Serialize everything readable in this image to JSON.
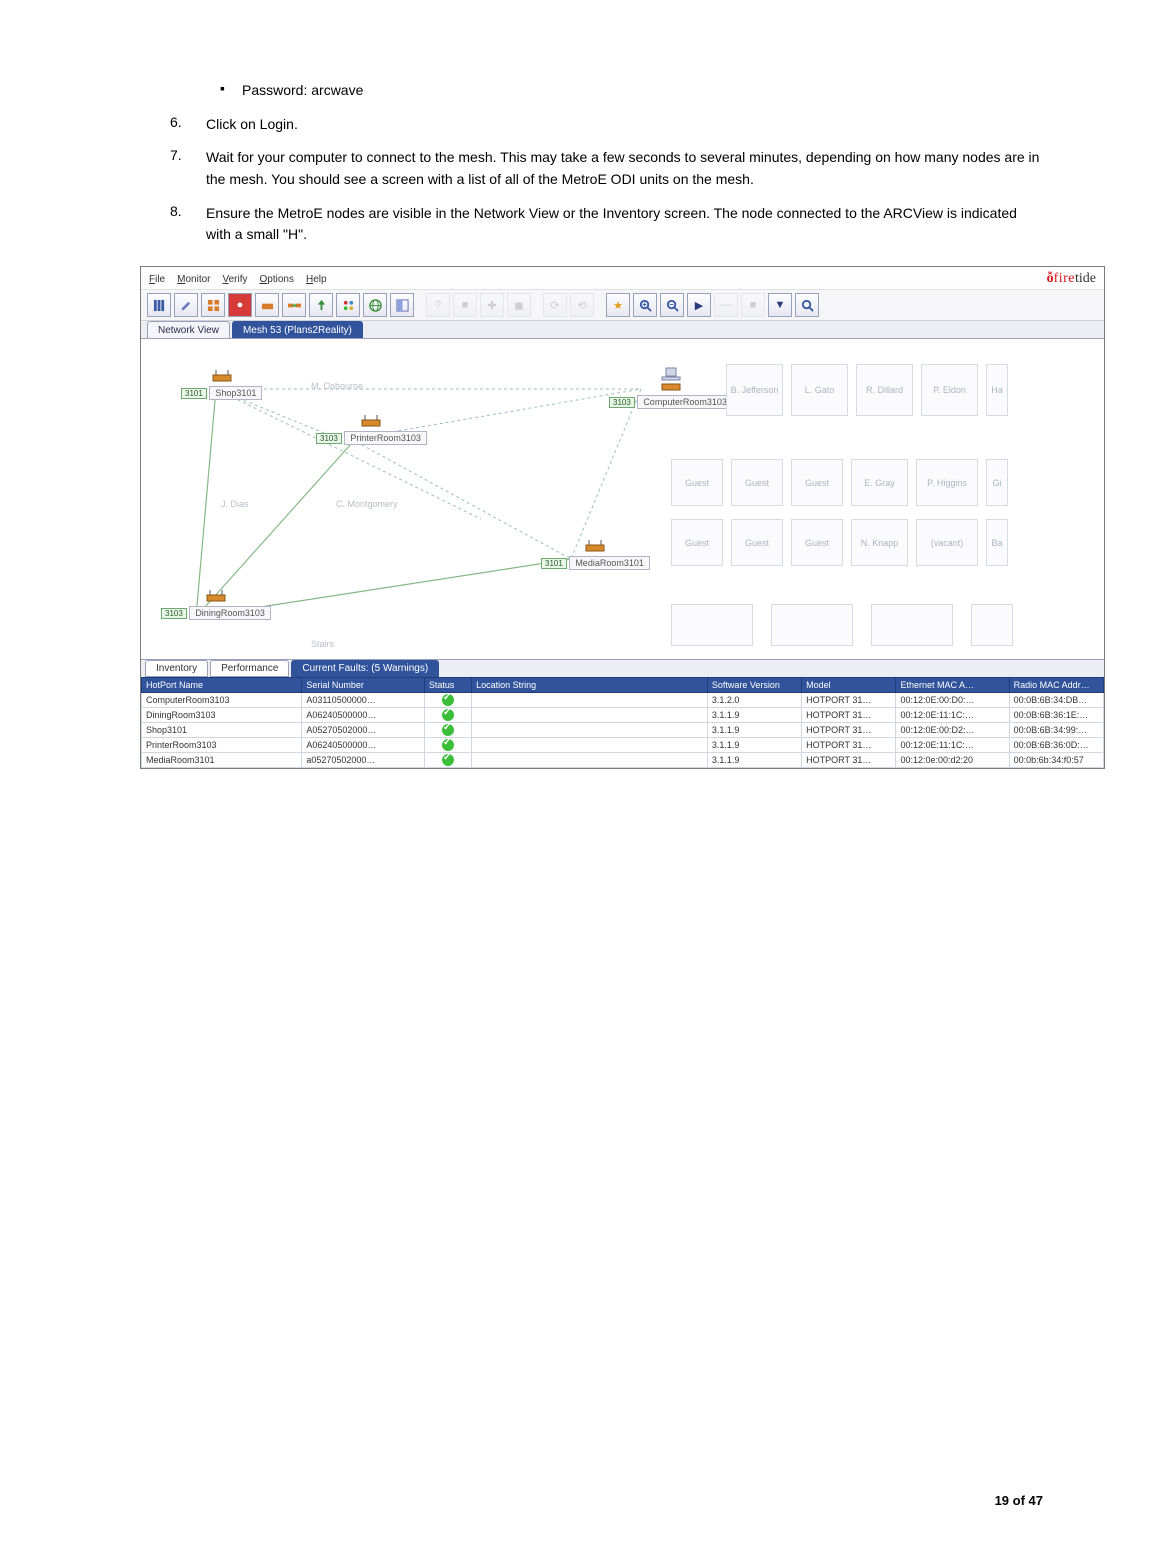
{
  "doc": {
    "bullet_pw_label": "Password: arcwave",
    "step6": "Click on Login.",
    "step7": "Wait for your computer to connect to the mesh. This may take a few seconds to several minutes, depending on how many nodes are in the mesh. You should see a screen with a list of all of the MetroE ODI units on the mesh.",
    "step8": "Ensure the MetroE nodes are visible in the Network View or the Inventory screen. The node connected to the ARCView is indicated with a small \"H\".",
    "page_num": "19 of 47"
  },
  "app": {
    "menu": {
      "file": "File",
      "monitor": "Monitor",
      "verify": "Verify",
      "options": "Options",
      "help": "Help"
    },
    "brand": {
      "name": "firetide"
    },
    "viewtabs": {
      "network": "Network View",
      "mesh": "Mesh 53 (Plans2Reality)"
    },
    "nodes": {
      "shop": {
        "tag": "3101",
        "label": "Shop3101"
      },
      "printer": {
        "tag": "3103",
        "label": "PrinterRoom3103",
        "person": "M. Osbourne"
      },
      "computer": {
        "tag": "3103",
        "label": "ComputerRoom3103"
      },
      "media": {
        "tag": "3101",
        "label": "MediaRoom3101"
      },
      "dining": {
        "tag": "3103",
        "label": "DiningRoom3103"
      },
      "jdias": "J. Dias",
      "cmont": "C. Montgomery",
      "stairs": "Stairs"
    },
    "ghosts_row1": [
      "B. Jefferson",
      "L. Gato",
      "R. Dillard",
      "P. Eldon",
      "Ha"
    ],
    "ghosts_row2": [
      "Guest",
      "Guest",
      "Guest",
      "E. Gray",
      "P. Higgins",
      "Gi"
    ],
    "ghosts_row3": [
      "Guest",
      "Guest",
      "Guest",
      "N. Knapp",
      "(vacant)",
      "Ba"
    ],
    "bottom_tabs": {
      "inventory": "Inventory",
      "performance": "Performance",
      "faults": "Current Faults: (5 Warnings)"
    },
    "inv": {
      "cols": {
        "name": "HotPort Name",
        "sn": "Serial Number",
        "status": "Status",
        "loc": "Location String",
        "ver": "Software Version",
        "model": "Model",
        "eth": "Ethernet MAC A…",
        "rad": "Radio MAC Addr…"
      },
      "rows": [
        {
          "name": "ComputerRoom3103",
          "sn": "A03110500000…",
          "ver": "3.1.2.0",
          "model": "HOTPORT 31…",
          "eth": "00:12:0E:00:D0:…",
          "rad": "00:0B:6B:34:DB…"
        },
        {
          "name": "DiningRoom3103",
          "sn": "A06240500000…",
          "ver": "3.1.1.9",
          "model": "HOTPORT 31…",
          "eth": "00:12:0E:11:1C:…",
          "rad": "00:0B:6B:36:1E:…"
        },
        {
          "name": "Shop3101",
          "sn": "A05270502000…",
          "ver": "3.1.1.9",
          "model": "HOTPORT 31…",
          "eth": "00:12:0E:00:D2:…",
          "rad": "00:0B:6B:34:99:…"
        },
        {
          "name": "PrinterRoom3103",
          "sn": "A06240500000…",
          "ver": "3.1.1.9",
          "model": "HOTPORT 31…",
          "eth": "00:12:0E:11:1C:…",
          "rad": "00:0B:6B:36:0D:…"
        },
        {
          "name": "MediaRoom3101",
          "sn": "a05270502000…",
          "ver": "3.1.1.9",
          "model": "HOTPORT 31…",
          "eth": "00:12:0e:00:d2:20",
          "rad": "00:0b:6b:34:f0:57"
        }
      ]
    }
  }
}
